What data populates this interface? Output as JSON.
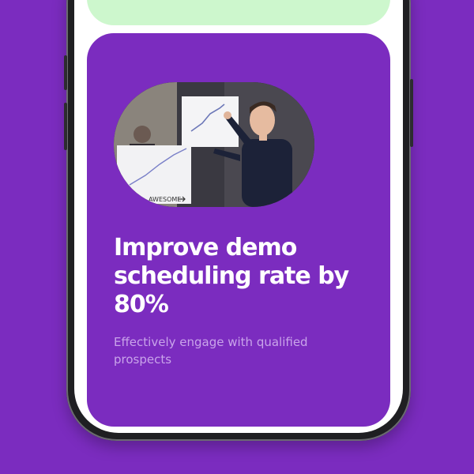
{
  "card": {
    "headline": "Improve demo scheduling rate by 80%",
    "subtext": "Effectively engage with qualified prospects",
    "photo_sign_text": "AWESOME"
  },
  "colors": {
    "background": "#7b2cbf",
    "top_card": "#cdf7cd",
    "text_primary": "#ffffff",
    "text_secondary": "#c9a4ea"
  }
}
